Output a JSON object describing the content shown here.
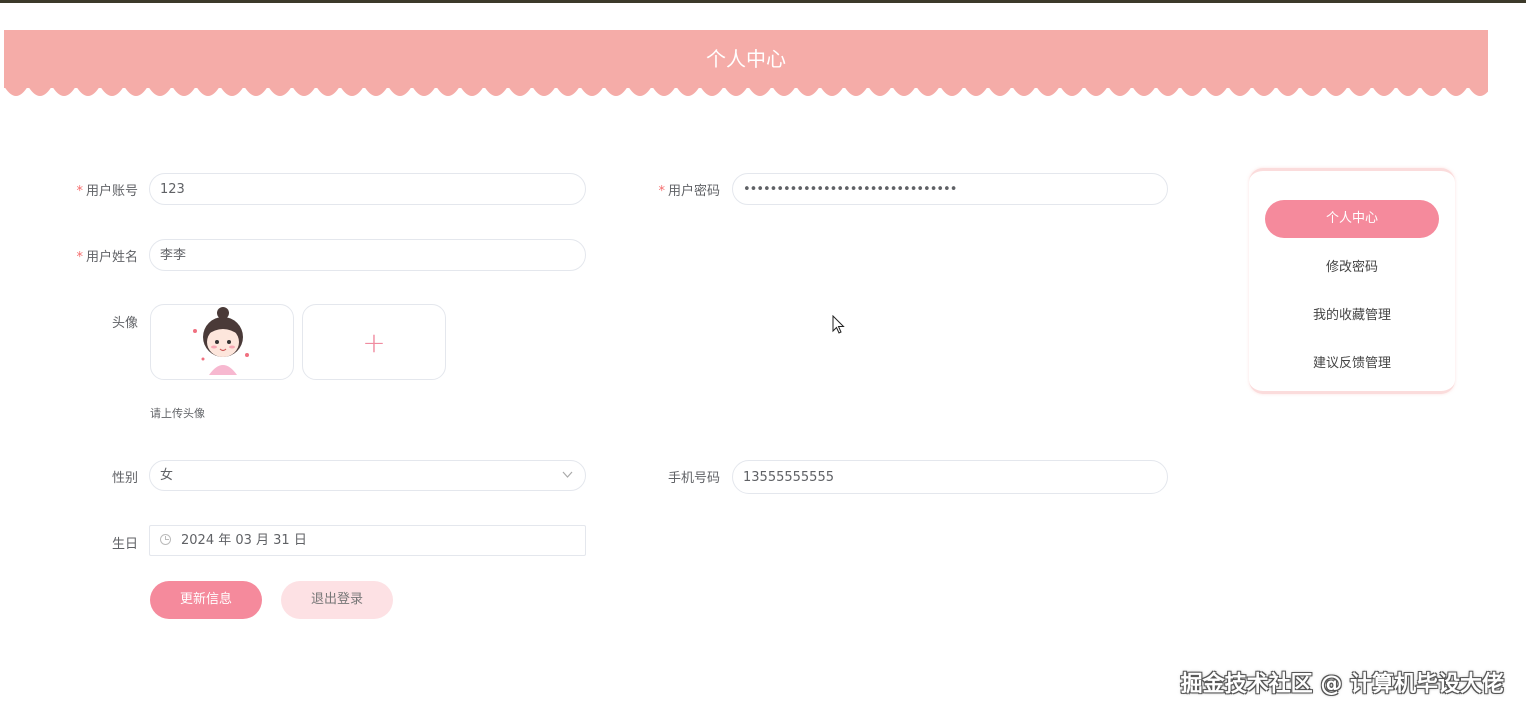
{
  "header": {
    "title": "个人中心"
  },
  "form": {
    "account": {
      "label": "用户账号",
      "value": "123"
    },
    "password": {
      "label": "用户密码",
      "value": "••••••••••••••••••••••••••••••••"
    },
    "name": {
      "label": "用户姓名",
      "value": "李李"
    },
    "avatar": {
      "label": "头像",
      "hint": "请上传头像",
      "add_icon": "+"
    },
    "gender": {
      "label": "性别",
      "value": "女"
    },
    "phone": {
      "label": "手机号码",
      "value": "13555555555"
    },
    "birthday": {
      "label": "生日",
      "value": "2024 年 03 月 31 日"
    },
    "required_mark": "*"
  },
  "buttons": {
    "update": "更新信息",
    "logout": "退出登录"
  },
  "sidebar": {
    "items": [
      {
        "label": "个人中心",
        "active": true
      },
      {
        "label": "修改密码",
        "active": false
      },
      {
        "label": "我的收藏管理",
        "active": false
      },
      {
        "label": "建议反馈管理",
        "active": false
      }
    ]
  },
  "watermark": "掘金技术社区 @ 计算机毕设大佬",
  "colors": {
    "banner": "#f5aca8",
    "accent": "#f58a9c",
    "light_button": "#fde1e4"
  }
}
